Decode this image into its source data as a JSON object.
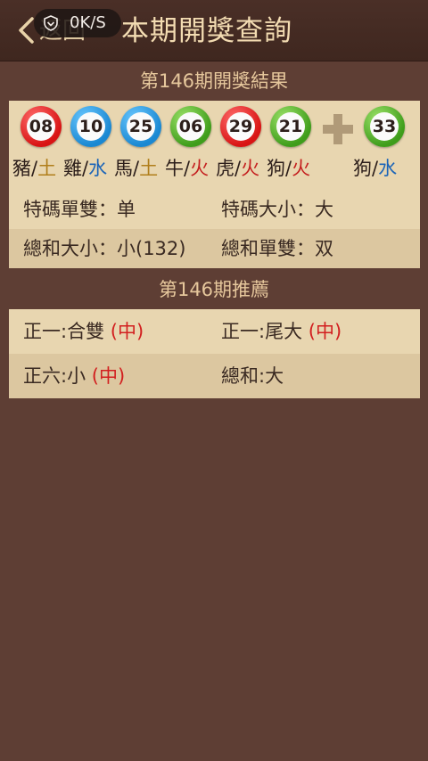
{
  "header": {
    "back_label": "返回",
    "title": "本期開獎查詢",
    "net_speed": "0K/S"
  },
  "result": {
    "title": "第146期開獎結果",
    "balls": [
      {
        "number": "08",
        "color": "red",
        "zodiac": "豬",
        "element": "土"
      },
      {
        "number": "10",
        "color": "blue",
        "zodiac": "雞",
        "element": "水"
      },
      {
        "number": "25",
        "color": "blue",
        "zodiac": "馬",
        "element": "土"
      },
      {
        "number": "06",
        "color": "green",
        "zodiac": "牛",
        "element": "火"
      },
      {
        "number": "29",
        "color": "red",
        "zodiac": "虎",
        "element": "火"
      },
      {
        "number": "21",
        "color": "green",
        "zodiac": "狗",
        "element": "火"
      }
    ],
    "special": {
      "number": "33",
      "color": "green",
      "zodiac": "狗",
      "element": "水"
    },
    "separator": "/",
    "stats": [
      {
        "label": "特碼單雙：",
        "value": "单"
      },
      {
        "label": "特碼大小：",
        "value": "大"
      },
      {
        "label": "總和大小：",
        "value": "小(132)"
      },
      {
        "label": "總和單雙：",
        "value": "双"
      }
    ]
  },
  "recommend": {
    "title": "第146期推薦",
    "items": [
      {
        "label": "正一:合雙",
        "mark": "(中)"
      },
      {
        "label": "正一:尾大",
        "mark": "(中)"
      },
      {
        "label": "正六:小",
        "mark": "(中)"
      },
      {
        "label": "總和:大",
        "mark": ""
      }
    ]
  },
  "colors": {
    "background": "#5e3e34",
    "panel": "#e8d6b0",
    "panel_alt": "#dcc7a0",
    "title_text": "#f3dcb2",
    "hit_mark": "#d21f1f"
  },
  "icons": {
    "back": "chevron-left-icon",
    "speed": "shield-arrow-icon",
    "plus": "plus-icon"
  }
}
